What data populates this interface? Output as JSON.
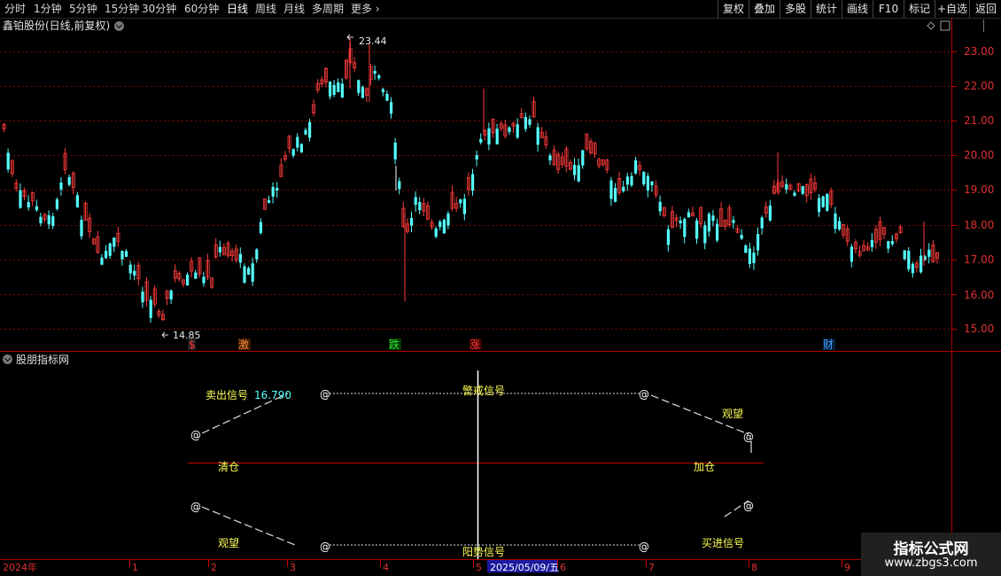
{
  "toolbar": {
    "periods": [
      "分时",
      "1分钟",
      "5分钟",
      "15分钟",
      "30分钟",
      "60分钟",
      "日线",
      "周线",
      "月线",
      "多周期",
      "更多"
    ],
    "active_period": "日线",
    "right_buttons": [
      "复权",
      "叠加",
      "多股",
      "统计",
      "画线",
      "F10",
      "标记",
      "+自选",
      "返回"
    ]
  },
  "stock_title": "鑫铂股份(日线,前复权)",
  "indicator_title": "股朋指标网",
  "price_axis": [
    "23.00",
    "22.00",
    "21.00",
    "20.00",
    "19.00",
    "18.00",
    "17.00",
    "16.00",
    "15.00"
  ],
  "high_marker": "23.44",
  "low_marker": "14.85",
  "event_tags": [
    {
      "text": "$",
      "color": "#ff3a3a"
    },
    {
      "text": "激",
      "color": "#ff8a3a"
    },
    {
      "text": "跌",
      "color": "#3adf3a"
    },
    {
      "text": "涨",
      "color": "#ff3a3a"
    },
    {
      "text": "财",
      "color": "#4a9fff"
    }
  ],
  "indicator": {
    "sell_label": "卖出信号",
    "sell_value": "16.790",
    "warning_label": "警戒信号",
    "watch_top": "观望",
    "clear_label": "清仓",
    "add_label": "加仓",
    "watch_bottom": "观望",
    "sunny_label": "阳势信号",
    "buy_label": "买进信号",
    "at_symbol": "@"
  },
  "time_axis": [
    "2024年",
    "1",
    "2",
    "3",
    "4",
    "5",
    "6",
    "7",
    "8",
    "9"
  ],
  "cursor_date": "2025/05/09/五",
  "watermark": {
    "line1": "指标公式网",
    "line2": "www.zbgs3.com"
  },
  "colors": {
    "up": "#ff3b3b",
    "down": "#54ffff",
    "grid": "#8a0000",
    "axis": "#c00000",
    "yellow": "#ffff54"
  }
}
